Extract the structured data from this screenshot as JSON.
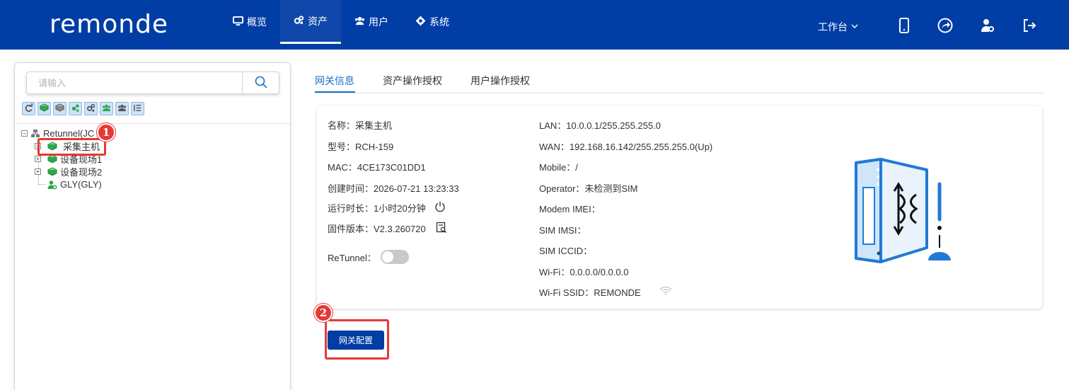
{
  "brand": {
    "logo_text": "remonde"
  },
  "nav": {
    "items": [
      {
        "label": "概览",
        "icon": "monitor-icon"
      },
      {
        "label": "资产",
        "icon": "gears-icon",
        "active": true
      },
      {
        "label": "用户",
        "icon": "users-icon"
      },
      {
        "label": "系统",
        "icon": "gear-icon"
      }
    ],
    "workbench": "工作台"
  },
  "header_icons": [
    "mobile-icon",
    "share-icon",
    "user-settings-icon",
    "logout-icon"
  ],
  "sidebar": {
    "search_placeholder": "请输入",
    "toolbar_icons": [
      "refresh-icon",
      "add-device-icon",
      "device-icon",
      "settings-icon",
      "gears-icon",
      "add-users-icon",
      "users-icon",
      "list-icon"
    ],
    "tree": [
      {
        "label": "Retunnel(JC",
        "icon": "network-root-icon",
        "level": 0
      },
      {
        "label": "采集主机",
        "icon": "device-icon",
        "level": 1,
        "selected": true
      },
      {
        "label": "设备现场1",
        "icon": "device-icon",
        "level": 1
      },
      {
        "label": "设备现场2",
        "icon": "device-icon",
        "level": 1
      },
      {
        "label": "GLY(GLY)",
        "icon": "user-settings-icon",
        "level": 1
      }
    ]
  },
  "tabs": [
    {
      "label": "网关信息",
      "active": true
    },
    {
      "label": "资产操作授权"
    },
    {
      "label": "用户操作授权"
    }
  ],
  "info_left": [
    {
      "label": "名称：",
      "value": "采集主机"
    },
    {
      "label": "型号：",
      "value": "RCH-159"
    },
    {
      "label": "MAC：",
      "value": "4CE173C01DD1"
    },
    {
      "label": "创建时间：",
      "value": "2026-07-21 13:23:33"
    },
    {
      "label": "运行时长：",
      "value": "1小时20分钟"
    },
    {
      "label": "固件版本：",
      "value": "V2.3.260720"
    }
  ],
  "retunnel": {
    "label": "ReTunnel：",
    "enabled": false
  },
  "info_right": [
    {
      "label": "LAN：",
      "value": "10.0.0.1/255.255.255.0"
    },
    {
      "label": "WAN：",
      "value": "192.168.16.142/255.255.255.0(Up)"
    },
    {
      "label": "Mobile：",
      "value": "/"
    },
    {
      "label": "Operator：",
      "value": "未检测到SIM"
    },
    {
      "label": "Modem IMEI：",
      "value": ""
    },
    {
      "label": "SIM IMSI：",
      "value": ""
    },
    {
      "label": "SIM ICCID：",
      "value": ""
    },
    {
      "label": "Wi-Fi：",
      "value": "0.0.0.0/0.0.0.0"
    },
    {
      "label": "Wi-Fi SSID：",
      "value": "REMONDE"
    }
  ],
  "config_button": "网关配置",
  "markers": [
    "1",
    "2"
  ],
  "colors": {
    "header_bg": "#003da5",
    "accent": "#1a73c9",
    "highlight": "#e53935",
    "device_green": "#2ea84a"
  }
}
